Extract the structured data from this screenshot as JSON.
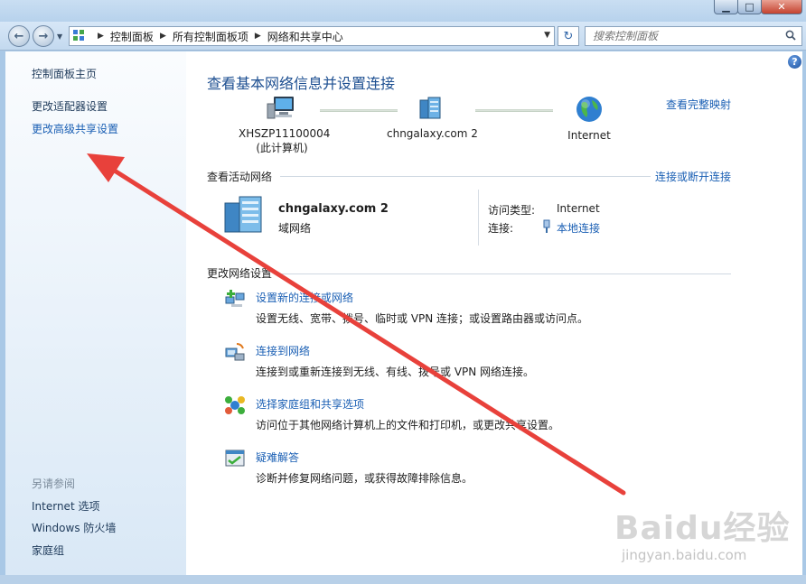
{
  "window": {
    "minimize_glyph": "▁",
    "maximize_glyph": "□",
    "close_glyph": "✕"
  },
  "navbar": {
    "breadcrumbs": [
      "控制面板",
      "所有控制面板项",
      "网络和共享中心"
    ],
    "search_placeholder": "搜索控制面板"
  },
  "sidebar": {
    "home_link": "控制面板主页",
    "links": [
      "更改适配器设置",
      "更改高级共享设置"
    ],
    "see_also_heading": "另请参阅",
    "see_also": [
      "Internet 选项",
      "Windows 防火墙",
      "家庭组"
    ]
  },
  "main": {
    "title": "查看基本网络信息并设置连接",
    "view_full_map": "查看完整映射",
    "map_nodes": [
      {
        "name": "XHSZP11100004",
        "sub": "(此计算机)"
      },
      {
        "name": "chngalaxy.com  2",
        "sub": ""
      },
      {
        "name": "Internet",
        "sub": ""
      }
    ],
    "active_networks_heading": "查看活动网络",
    "connect_disconnect_link": "连接或断开连接",
    "active_network": {
      "name": "chngalaxy.com  2",
      "category": "域网络",
      "access_type_label": "访问类型:",
      "access_type_value": "Internet",
      "connections_label": "连接:",
      "connections_value": "本地连接"
    },
    "change_settings_heading": "更改网络设置",
    "tasks": [
      {
        "title": "设置新的连接或网络",
        "desc": "设置无线、宽带、拨号、临时或 VPN 连接；或设置路由器或访问点。"
      },
      {
        "title": "连接到网络",
        "desc": "连接到或重新连接到无线、有线、拨号或 VPN 网络连接。"
      },
      {
        "title": "选择家庭组和共享选项",
        "desc": "访问位于其他网络计算机上的文件和打印机，或更改共享设置。"
      },
      {
        "title": "疑难解答",
        "desc": "诊断并修复网络问题，或获得故障排除信息。"
      }
    ]
  },
  "watermark": {
    "brand": "Baidu经验",
    "url": "jingyan.baidu.com"
  },
  "colors": {
    "link": "#1a5fb4",
    "title": "#1d4f91",
    "annotation_arrow": "#e8413b"
  }
}
